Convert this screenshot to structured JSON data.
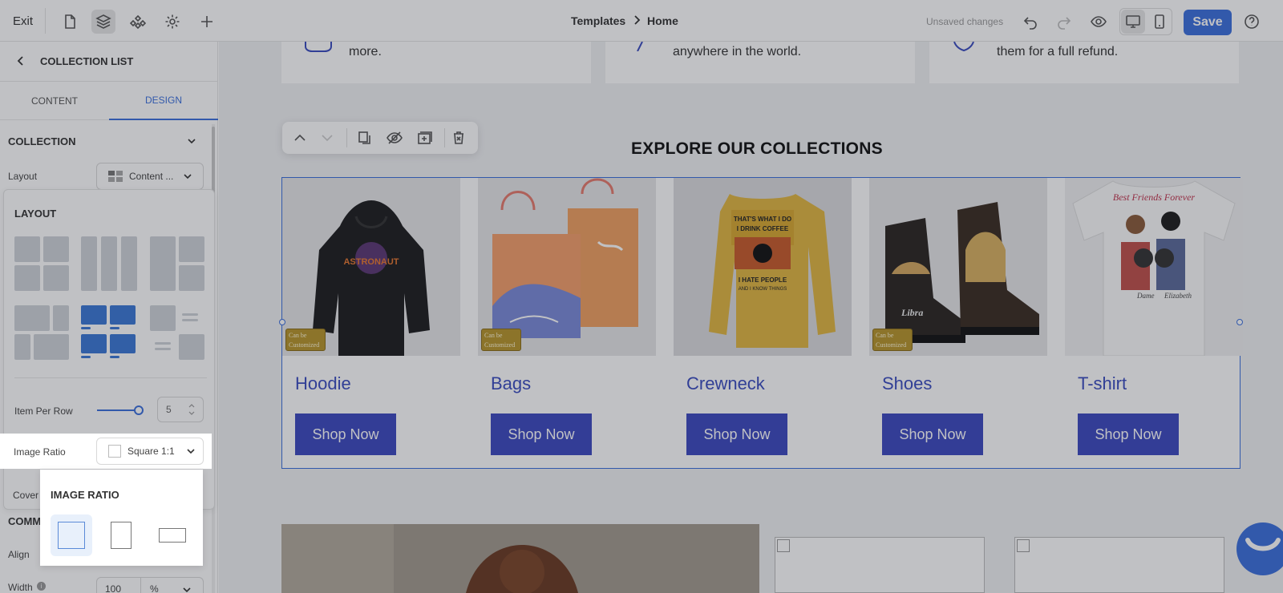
{
  "topbar": {
    "exit_label": "Exit",
    "breadcrumb": [
      "Templates",
      "Home"
    ],
    "unsaved": "Unsaved changes",
    "save_label": "Save"
  },
  "panel": {
    "title": "COLLECTION LIST",
    "tabs": [
      {
        "label": "CONTENT",
        "active": false
      },
      {
        "label": "DESIGN",
        "active": true
      }
    ],
    "collection_section": "COLLECTION",
    "layout_label": "Layout",
    "layout_value": "Content ...",
    "layout_popover_title": "LAYOUT",
    "item_per_row_label": "Item Per Row",
    "item_per_row_value": "5",
    "image_ratio_label": "Image Ratio",
    "image_ratio_value": "Square 1:1",
    "cover_label": "Cover",
    "common_section": "COMM",
    "align_label": "Align",
    "width_label": "Width",
    "width_value": "100",
    "width_unit": "%"
  },
  "image_ratio_popover": {
    "title": "IMAGE RATIO",
    "options": [
      "square",
      "portrait",
      "landscape"
    ],
    "selected": "square"
  },
  "canvas": {
    "features": [
      "more.",
      "anywhere in the world.",
      "them for a full refund."
    ],
    "heading": "EXPLORE OUR COLLECTIONS",
    "collections": [
      {
        "title": "Hoodie",
        "button": "Shop Now",
        "badge": true
      },
      {
        "title": "Bags",
        "button": "Shop Now",
        "badge": true
      },
      {
        "title": "Crewneck",
        "button": "Shop Now",
        "badge": false
      },
      {
        "title": "Shoes",
        "button": "Shop Now",
        "badge": true
      },
      {
        "title": "T-shirt",
        "button": "Shop Now",
        "badge": false
      }
    ],
    "badge_text": "Can be Customized",
    "shirt_text": "Best Friends Forever",
    "crewneck_text_top": "THAT'S WHAT I DO I DRINK COFFEE",
    "crewneck_text_bottom": "I HATE PEOPLE AND I KNOW THINGS",
    "hoodie_text": "ASTRONAUT",
    "shoe_text": "Libra"
  },
  "colors": {
    "accent": "#3b6fdd",
    "button": "#3c48c0",
    "title": "#3a4cc0"
  }
}
